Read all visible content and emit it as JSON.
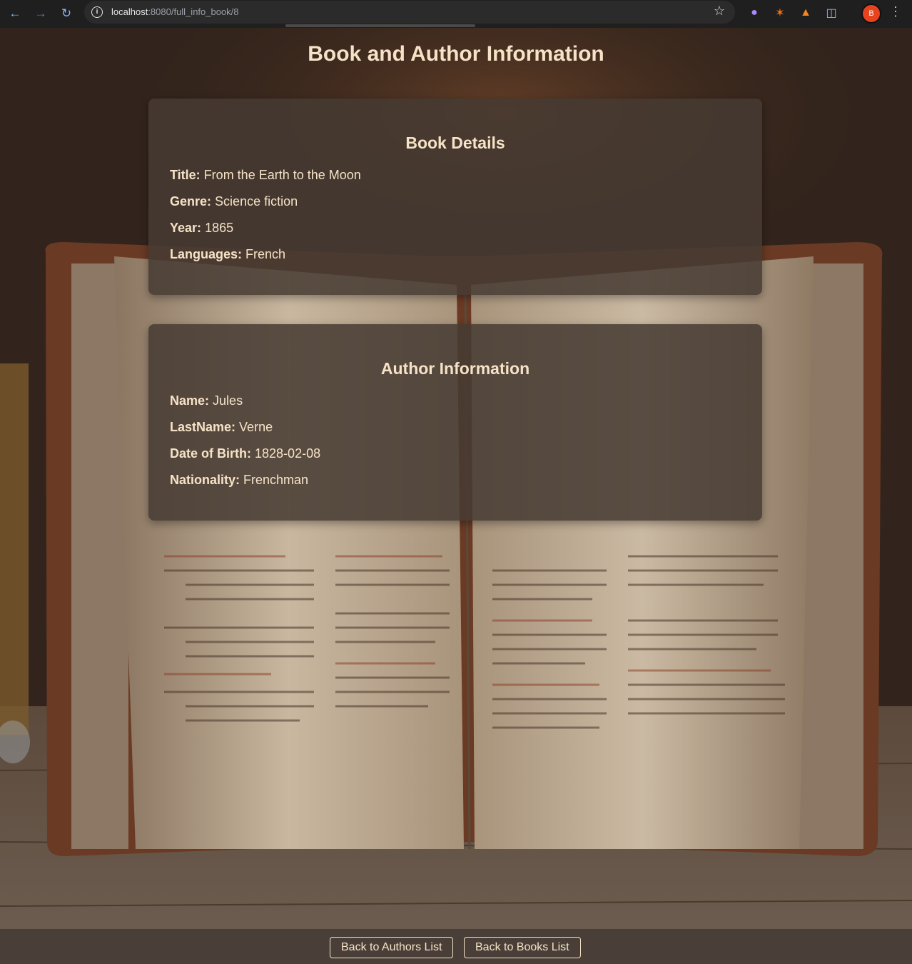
{
  "browser": {
    "url_host": "localhost",
    "url_path": ":8080/full_info_book/8",
    "profile_initial": "B"
  },
  "page": {
    "title": "Book and Author Information"
  },
  "book": {
    "heading": "Book Details",
    "title_label": "Title:",
    "title_value": "From the Earth to the Moon",
    "genre_label": "Genre:",
    "genre_value": "Science fiction",
    "year_label": "Year:",
    "year_value": "1865",
    "languages_label": "Languages:",
    "languages_value": "French"
  },
  "author": {
    "heading": "Author Information",
    "name_label": "Name:",
    "name_value": "Jules",
    "lastname_label": "LastName:",
    "lastname_value": "Verne",
    "dob_label": "Date of Birth:",
    "dob_value": "1828-02-08",
    "nationality_label": "Nationality:",
    "nationality_value": "Frenchman"
  },
  "footer": {
    "authors_button": "Back to Authors List",
    "books_button": "Back to Books List"
  },
  "icons": {
    "back": "back-arrow-icon",
    "forward": "forward-arrow-icon",
    "reload": "reload-icon",
    "bookmark": "star-icon"
  }
}
